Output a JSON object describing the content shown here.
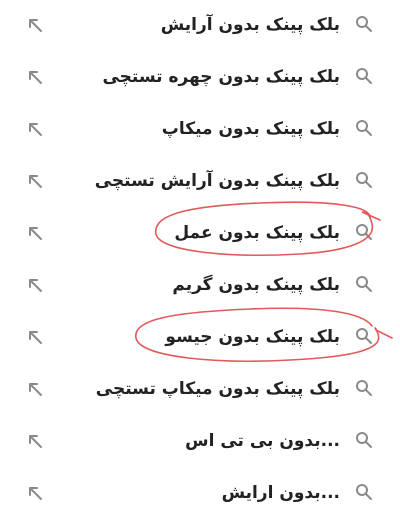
{
  "suggestions": [
    {
      "label": "بلک پینک بدون آرایش"
    },
    {
      "label": "بلک پینک بدون چهره تستچی"
    },
    {
      "label": "بلک پینک بدون میکاپ"
    },
    {
      "label": "بلک پینک بدون آرایش تستچی"
    },
    {
      "label": "بلک پینک بدون عمل"
    },
    {
      "label": "بلک پینک بدون گریم"
    },
    {
      "label": "بلک پینک بدون جیسو"
    },
    {
      "label": "بلک پینک بدون میکاپ تستچی"
    },
    {
      "label": "...بدون بی تی اس"
    },
    {
      "label": "...بدون ارایش"
    }
  ],
  "icons": {
    "search": "search-icon",
    "fill_query": "arrow-up-left-icon"
  },
  "colors": {
    "text": "#222222",
    "icon": "#8a8a8a",
    "annotation": "#e05a5a"
  }
}
